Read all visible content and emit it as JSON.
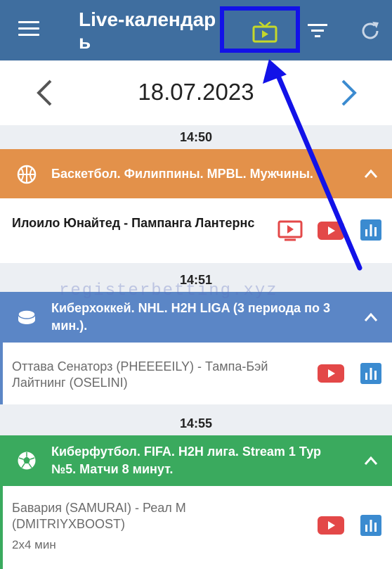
{
  "appbar": {
    "title": "Live-календарь",
    "icons": [
      "menu-icon",
      "tv-icon",
      "filter-icon",
      "refresh-icon"
    ],
    "highlight_color": "#1212e8"
  },
  "datebar": {
    "date": "18.07.2023"
  },
  "groups": [
    {
      "time": "14:50",
      "league": "Баскетбол. Филиппины. MPBL. Мужчины.",
      "sport_icon": "basketball-icon",
      "color": "#e3914a",
      "match": "Илоило Юнайтед - Пампанга Лантернс",
      "duration": ""
    },
    {
      "time": "14:51",
      "league": "Киберхоккей. NHL. H2H LIGA (3 периода по 3 мин.).",
      "sport_icon": "hockey-puck-icon",
      "color": "#5b86c6",
      "match": "Оттава Сенаторз (PHEEEEILY) - Тампа-Бэй Лайтнинг (OSELINI)",
      "duration": ""
    },
    {
      "time": "14:55",
      "league": "Киберфутбол. FIFA. H2H лига. Stream 1 Тур №5. Матчи 8 минут.",
      "sport_icon": "soccer-ball-icon",
      "color": "#3aaa5e",
      "match": "Бавария (SAMURAI) - Реал М (DMITRIYXBOOST)",
      "duration": "2x4 мин"
    }
  ],
  "watermark": "registerbetting.xyz"
}
